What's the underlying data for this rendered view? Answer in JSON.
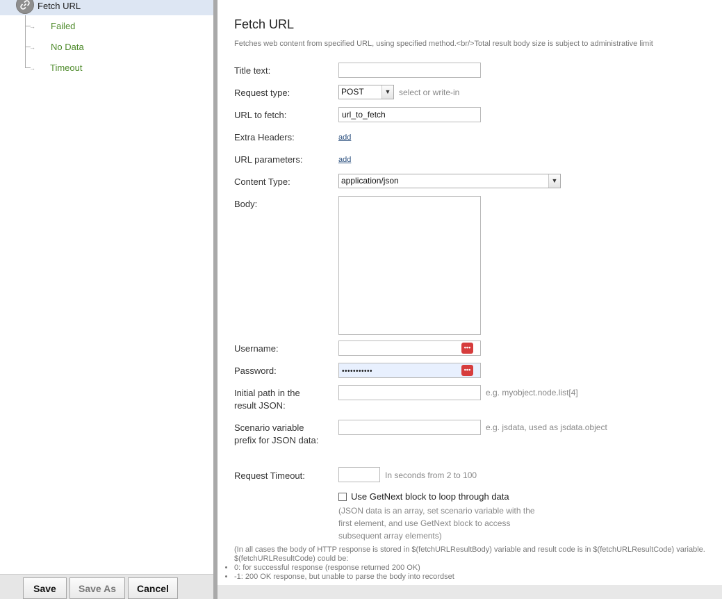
{
  "tree": {
    "root_label": "Fetch URL",
    "branches": [
      {
        "label": "Failed"
      },
      {
        "label": "No Data"
      },
      {
        "label": "Timeout"
      }
    ]
  },
  "buttons": {
    "save": "Save",
    "save_as": "Save As",
    "cancel": "Cancel"
  },
  "form": {
    "title": "Fetch URL",
    "description": "Fetches web content from specified URL, using specified method.<br/>Total result body size is subject to administrative limit",
    "fields": {
      "title_text": {
        "label": "Title text:",
        "value": ""
      },
      "request_type": {
        "label": "Request type:",
        "value": "POST",
        "hint": "select or write-in"
      },
      "url": {
        "label": "URL to fetch:",
        "value": "url_to_fetch"
      },
      "extra_headers": {
        "label": "Extra Headers:",
        "link": "add"
      },
      "url_parameters": {
        "label": "URL parameters:",
        "link": "add"
      },
      "content_type": {
        "label": "Content Type:",
        "value": "application/json"
      },
      "body": {
        "label": "Body:",
        "value": ""
      },
      "username": {
        "label": "Username:",
        "value": ""
      },
      "password": {
        "label": "Password:",
        "value": "•••••••••••"
      },
      "initial_path": {
        "label": "Initial path in the result JSON:",
        "value": "",
        "hint": "e.g. myobject.node.list[4]"
      },
      "scenario_prefix": {
        "label": "Scenario variable prefix for JSON data:",
        "value": "",
        "hint": "e.g. jsdata, used as jsdata.object"
      },
      "request_timeout": {
        "label": "Request Timeout:",
        "value": "",
        "hint": "In seconds from 2 to 100"
      }
    },
    "getnext": {
      "label": "Use GetNext block to loop through data",
      "checked": false,
      "note": "(JSON data is an array, set scenario variable with the first element, and use GetNext block to access subsequent array elements)"
    },
    "footer": {
      "note": "(In all cases the body of HTTP response is stored in $(fetchURLResultBody) variable and result code is in $(fetchURLResultCode) variable. $(fetchURLResultCode) could be:",
      "items": [
        "0: for successful response (response returned 200 OK)",
        "-1: 200 OK response, but unable to parse the body into recordset"
      ]
    }
  },
  "colors": {
    "branch_text": "#4d8a2a",
    "selected_row": "#dde6f3",
    "key_icon": "#d63c3c"
  }
}
